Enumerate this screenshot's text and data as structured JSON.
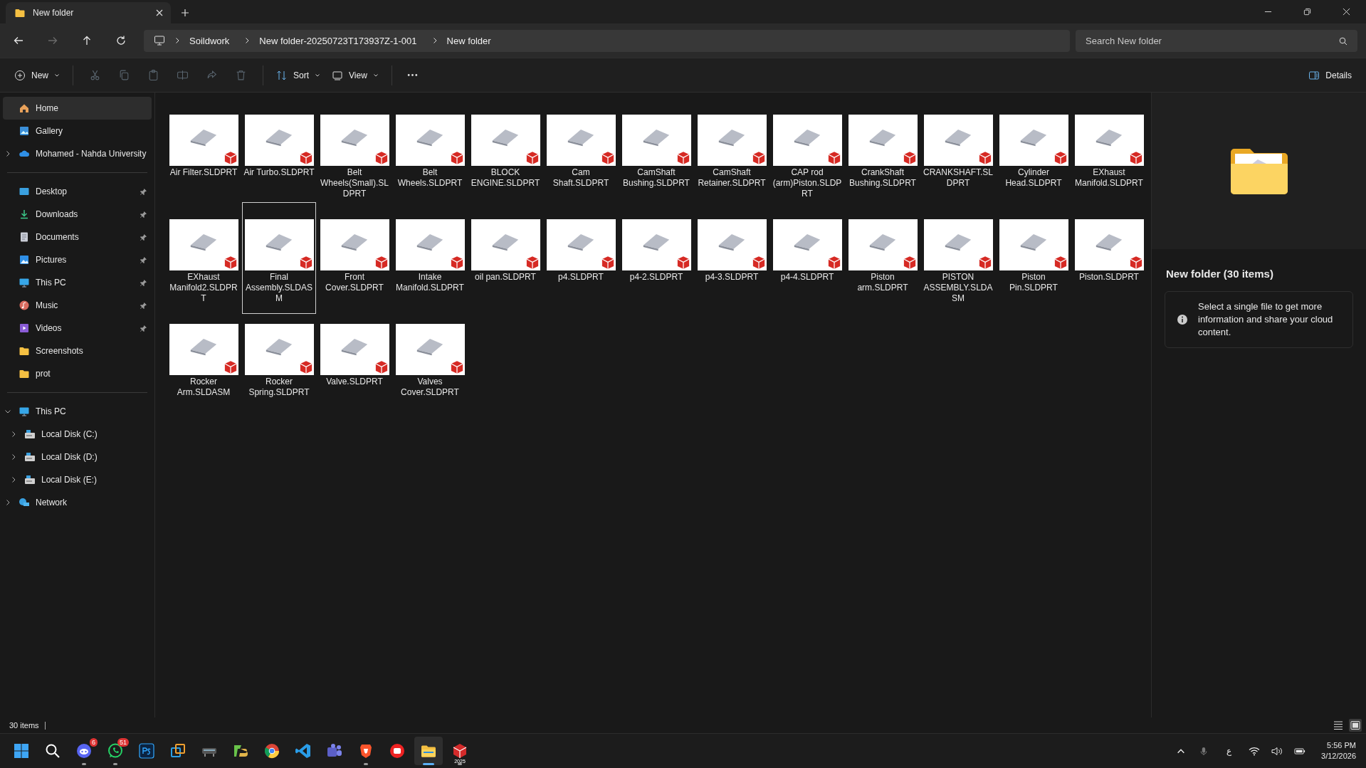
{
  "window": {
    "tab_title": "New folder"
  },
  "navigation": {
    "back_disabled": false,
    "forward_disabled": true,
    "up_disabled": false
  },
  "breadcrumb": [
    "Soildwork",
    "New folder-20250723T173937Z-1-001",
    "New folder"
  ],
  "search": {
    "placeholder": "Search New folder"
  },
  "command_bar": {
    "new_label": "New",
    "actions": [
      {
        "kind": "cut",
        "disabled": true
      },
      {
        "kind": "copy",
        "disabled": true
      },
      {
        "kind": "paste",
        "disabled": true
      },
      {
        "kind": "rename",
        "disabled": true
      },
      {
        "kind": "share",
        "disabled": true
      },
      {
        "kind": "delete",
        "disabled": true
      }
    ],
    "sort_label": "Sort",
    "view_label": "View",
    "details_label": "Details"
  },
  "sidebar": {
    "sections": [
      {
        "items": [
          {
            "label": "Home",
            "kind": "home",
            "selected": true
          },
          {
            "label": "Gallery",
            "kind": "gallery",
            "selected": false
          },
          {
            "label": "Mohamed - Nahda University",
            "kind": "cloud",
            "selected": false,
            "expanded": false
          }
        ]
      },
      {
        "items": [
          {
            "label": "Desktop",
            "kind": "desktop",
            "selected": false,
            "pinned": true
          },
          {
            "label": "Downloads",
            "kind": "downloads",
            "selected": false,
            "pinned": true
          },
          {
            "label": "Documents",
            "kind": "documents",
            "selected": false,
            "pinned": true
          },
          {
            "label": "Pictures",
            "kind": "pictures",
            "selected": false,
            "pinned": true
          },
          {
            "label": "This PC",
            "kind": "pc",
            "selected": false,
            "pinned": true
          },
          {
            "label": "Music",
            "kind": "music",
            "selected": false,
            "pinned": true
          },
          {
            "label": "Videos",
            "kind": "videos",
            "selected": false,
            "pinned": true
          },
          {
            "label": "Screenshots",
            "kind": "folder",
            "selected": false,
            "pinned": false
          },
          {
            "label": "prot",
            "kind": "folder",
            "selected": false,
            "pinned": false
          }
        ]
      },
      {
        "items": [
          {
            "label": "This PC",
            "kind": "pc",
            "selected": false,
            "expanded": true,
            "children": [
              {
                "label": "Local Disk (C:)",
                "kind": "disk",
                "selected": false,
                "expanded": false
              },
              {
                "label": "Local Disk (D:)",
                "kind": "disk",
                "selected": false,
                "expanded": false
              },
              {
                "label": "Local Disk (E:)",
                "kind": "disk",
                "selected": false,
                "expanded": false
              }
            ]
          },
          {
            "label": "Network",
            "kind": "network",
            "selected": false,
            "expanded": false
          }
        ]
      }
    ]
  },
  "files": [
    {
      "name": "Air Filter.SLDPRT",
      "selected": false
    },
    {
      "name": "Air Turbo.SLDPRT",
      "selected": false
    },
    {
      "name": "Belt Wheels(Small).SLDPRT",
      "selected": false
    },
    {
      "name": "Belt Wheels.SLDPRT",
      "selected": false
    },
    {
      "name": "BLOCK ENGINE.SLDPRT",
      "selected": false
    },
    {
      "name": "Cam Shaft.SLDPRT",
      "selected": false
    },
    {
      "name": "CamShaft Bushing.SLDPRT",
      "selected": false
    },
    {
      "name": "CamShaft Retainer.SLDPRT",
      "selected": false
    },
    {
      "name": "CAP rod (arm)Piston.SLDPRT",
      "selected": false
    },
    {
      "name": "CrankShaft Bushing.SLDPRT",
      "selected": false
    },
    {
      "name": "CRANKSHAFT.SLDPRT",
      "selected": false
    },
    {
      "name": "Cylinder Head.SLDPRT",
      "selected": false
    },
    {
      "name": "EXhaust Manifold.SLDPRT",
      "selected": false
    },
    {
      "name": "EXhaust Manifold2.SLDPRT",
      "selected": false
    },
    {
      "name": "Final Assembly.SLDASM",
      "selected": true
    },
    {
      "name": "Front Cover.SLDPRT",
      "selected": false
    },
    {
      "name": "Intake Manifold.SLDPRT",
      "selected": false
    },
    {
      "name": "oil pan.SLDPRT",
      "selected": false
    },
    {
      "name": "p4.SLDPRT",
      "selected": false
    },
    {
      "name": "p4-2.SLDPRT",
      "selected": false
    },
    {
      "name": "p4-3.SLDPRT",
      "selected": false
    },
    {
      "name": "p4-4.SLDPRT",
      "selected": false
    },
    {
      "name": "Piston arm.SLDPRT",
      "selected": false
    },
    {
      "name": "PISTON ASSEMBLY.SLDASM",
      "selected": false
    },
    {
      "name": "Piston Pin.SLDPRT",
      "selected": false
    },
    {
      "name": "Piston.SLDPRT",
      "selected": false
    },
    {
      "name": "Rocker Arm.SLDASM",
      "selected": false
    },
    {
      "name": "Rocker Spring.SLDPRT",
      "selected": false
    },
    {
      "name": "Valve.SLDPRT",
      "selected": false
    },
    {
      "name": "Valves Cover.SLDPRT",
      "selected": false
    }
  ],
  "details_pane": {
    "title": "New folder (30 items)",
    "info": "Select a single file to get more information and share your cloud content."
  },
  "status_bar": {
    "item_count": "30 items",
    "view_modes": [
      {
        "kind": "details",
        "selected": false
      },
      {
        "kind": "tiles",
        "selected": true
      }
    ]
  },
  "taskbar": {
    "apps": [
      {
        "kind": "start",
        "running": false,
        "active": false
      },
      {
        "kind": "search",
        "running": false,
        "active": false
      },
      {
        "kind": "chat",
        "badge": "6",
        "running": true,
        "active": false
      },
      {
        "kind": "phone",
        "badge": "51",
        "running": true,
        "active": false
      },
      {
        "kind": "editor",
        "running": false,
        "active": false
      },
      {
        "kind": "squares",
        "running": false,
        "active": false
      },
      {
        "kind": "device",
        "running": false,
        "active": false
      },
      {
        "kind": "green",
        "running": false,
        "active": false
      },
      {
        "kind": "browser",
        "running": false,
        "active": false
      },
      {
        "kind": "code",
        "running": false,
        "active": false
      },
      {
        "kind": "people",
        "running": false,
        "active": false
      },
      {
        "kind": "shield",
        "running": true,
        "active": false
      },
      {
        "kind": "redcircle",
        "running": false,
        "active": false
      },
      {
        "kind": "explorer",
        "running": true,
        "active": true
      },
      {
        "kind": "cube",
        "caption": "2025",
        "running": true,
        "active": false
      }
    ],
    "tray": {
      "language": "ع",
      "time": "5:56 PM",
      "date": "3/12/2026"
    }
  }
}
